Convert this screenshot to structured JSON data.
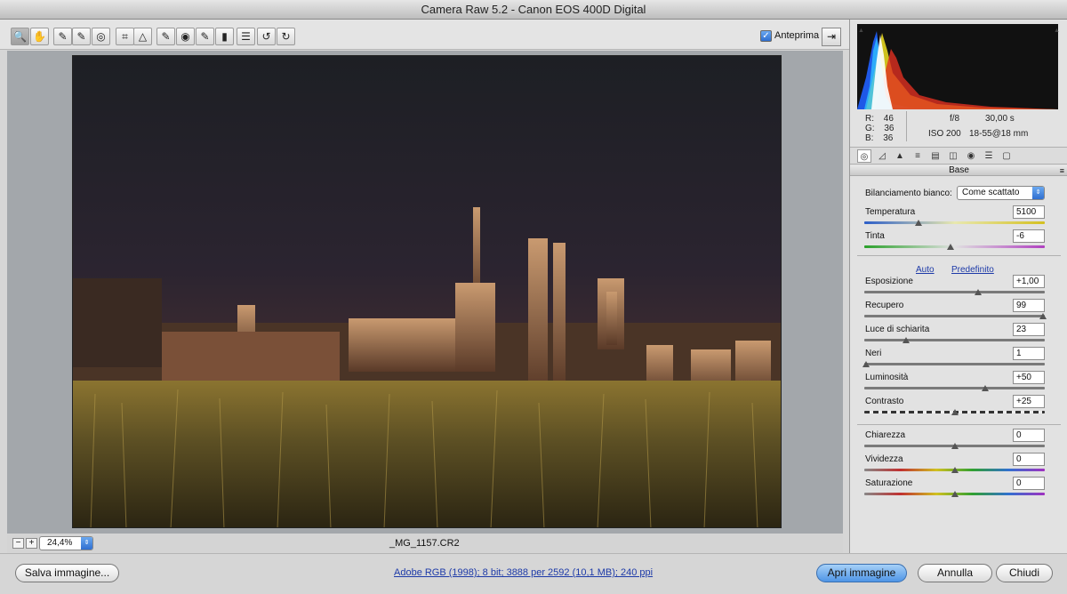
{
  "window": {
    "title": "Camera Raw 5.2  -  Canon EOS 400D Digital"
  },
  "toolbar": {
    "tools": [
      {
        "name": "zoom-tool",
        "glyph": "🔍"
      },
      {
        "name": "hand-tool",
        "glyph": "✋"
      },
      {
        "name": "white-balance-tool",
        "glyph": "✎"
      },
      {
        "name": "color-sampler-tool",
        "glyph": "✎"
      },
      {
        "name": "targeted-adjustment-tool",
        "glyph": "◎"
      },
      {
        "name": "crop-tool",
        "glyph": "⌗"
      },
      {
        "name": "straighten-tool",
        "glyph": "△"
      },
      {
        "name": "spot-removal-tool",
        "glyph": "✎"
      },
      {
        "name": "red-eye-tool",
        "glyph": "◉"
      },
      {
        "name": "adjustment-brush-tool",
        "glyph": "✎"
      },
      {
        "name": "graduated-filter-tool",
        "glyph": "▮"
      },
      {
        "name": "preferences-tool",
        "glyph": "☰"
      },
      {
        "name": "rotate-ccw-tool",
        "glyph": "↺"
      },
      {
        "name": "rotate-cw-tool",
        "glyph": "↻"
      }
    ],
    "preview_label": "Anteprima",
    "preview_checked": true
  },
  "status": {
    "zoom": "24,4%",
    "filename": "_MG_1157.CR2"
  },
  "bottom": {
    "save_label": "Salva immagine...",
    "workflow_info": "Adobe RGB (1998); 8 bit; 3888 per 2592 (10,1 MB); 240 ppi",
    "open_label": "Apri immagine",
    "cancel_label": "Annulla",
    "close_label": "Chiudi"
  },
  "readout": {
    "r_label": "R:",
    "r": "46",
    "g_label": "G:",
    "g": "36",
    "b_label": "B:",
    "b": "36",
    "aperture": "f/8",
    "shutter": "30,00 s",
    "iso": "ISO 200",
    "lens": "18-55@18 mm"
  },
  "panel": {
    "title": "Base",
    "wb_label": "Bilanciamento bianco:",
    "wb_value": "Come scattato",
    "auto_label": "Auto",
    "default_label": "Predefinito",
    "sliders": [
      {
        "id": "temperatura",
        "label": "Temperatura",
        "value": "5100",
        "pos": 0.3,
        "gradient": "linear-gradient(90deg,#2c5ec8,#e8e8b0,#d4c020)"
      },
      {
        "id": "tinta",
        "label": "Tinta",
        "value": "-6",
        "pos": 0.48,
        "gradient": "linear-gradient(90deg,#2aa02a,#e0e0e0,#b040c0)"
      },
      {
        "id": "esposizione",
        "label": "Esposizione",
        "value": "+1,00",
        "pos": 0.63,
        "gradient": ""
      },
      {
        "id": "recupero",
        "label": "Recupero",
        "value": "99",
        "pos": 0.99,
        "gradient": ""
      },
      {
        "id": "luce-schiarita",
        "label": "Luce di schiarita",
        "value": "23",
        "pos": 0.23,
        "gradient": ""
      },
      {
        "id": "neri",
        "label": "Neri",
        "value": "1",
        "pos": 0.01,
        "gradient": ""
      },
      {
        "id": "luminosita",
        "label": "Luminosità",
        "value": "+50",
        "pos": 0.67,
        "gradient": ""
      },
      {
        "id": "contrasto",
        "label": "Contrasto",
        "value": "+25",
        "pos": 0.5,
        "gradient": "dashed"
      },
      {
        "id": "chiarezza",
        "label": "Chiarezza",
        "value": "0",
        "pos": 0.5,
        "gradient": ""
      },
      {
        "id": "vividezza",
        "label": "Vividezza",
        "value": "0",
        "pos": 0.5,
        "gradient": "linear-gradient(90deg,#888,#c03030,#d0c020,#30a030,#3070d0,#a030c0)"
      },
      {
        "id": "saturazione",
        "label": "Saturazione",
        "value": "0",
        "pos": 0.5,
        "gradient": "linear-gradient(90deg,#888,#c03030,#d0c020,#30a030,#3070d0,#a030c0)"
      }
    ]
  },
  "panel_tabs": [
    "basic-icon",
    "tone-curve-icon",
    "detail-icon",
    "hsl-icon",
    "split-toning-icon",
    "lens-corrections-icon",
    "camera-calibration-icon",
    "presets-icon",
    "snapshots-icon"
  ]
}
